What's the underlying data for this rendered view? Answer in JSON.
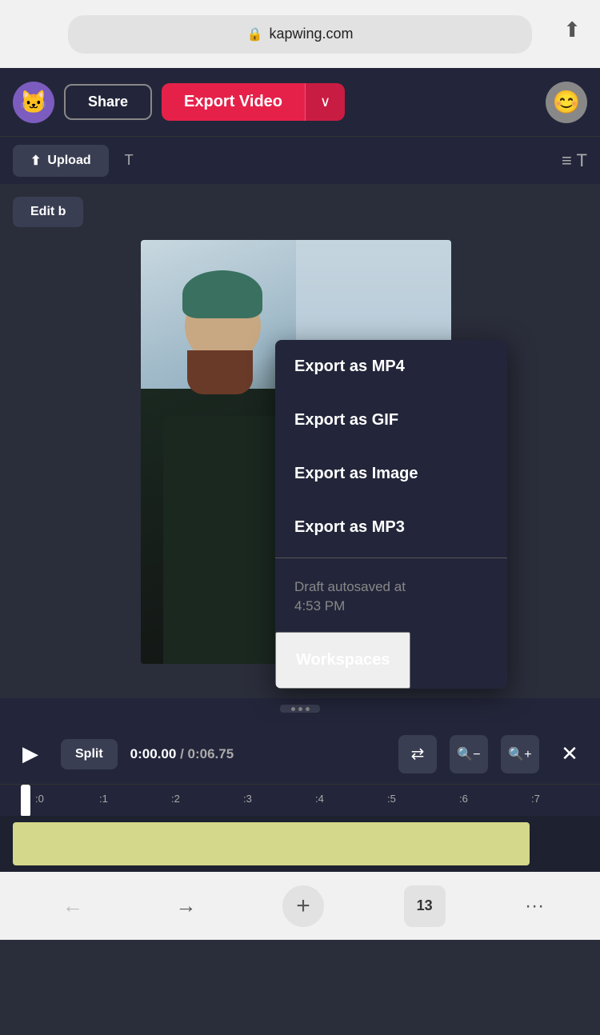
{
  "browser": {
    "url": "kapwing.com",
    "tab_count": "13"
  },
  "topnav": {
    "logo_emoji": "🐱",
    "share_label": "Share",
    "export_label": "Export Video",
    "user_emoji": "😊"
  },
  "secondarynav": {
    "upload_label": "Upload"
  },
  "editbar": {
    "edit_label": "Edit b"
  },
  "dropdown": {
    "items": [
      {
        "id": "mp4",
        "label": "Export as MP4"
      },
      {
        "id": "gif",
        "label": "Export as GIF"
      },
      {
        "id": "image",
        "label": "Export as Image"
      },
      {
        "id": "mp3",
        "label": "Export as MP3"
      }
    ],
    "autosave_label": "Draft autosaved at\n4:53 PM",
    "workspaces_label": "Workspaces"
  },
  "playback": {
    "split_label": "Split",
    "time_current": "0:00.00",
    "time_separator": " / ",
    "time_total": "0:06.75"
  },
  "ruler": {
    "markers": [
      ":0",
      ":1",
      ":2",
      ":3",
      ":4",
      ":5",
      ":6",
      ":7"
    ]
  },
  "icons": {
    "lock": "🔒",
    "share_ios": "⬆",
    "upload_arrow": "⬆",
    "chevron_down": "∨",
    "play": "▶",
    "swap": "⇄",
    "zoom_out": "🔍",
    "zoom_in": "🔍",
    "close": "✕",
    "back": "←",
    "forward": "→",
    "add_tab": "+",
    "more": "···"
  },
  "colors": {
    "accent_red": "#e5214a",
    "bg_dark": "#23263a",
    "bg_main": "#2a2d3a",
    "timeline_clip": "#d4d88a"
  }
}
